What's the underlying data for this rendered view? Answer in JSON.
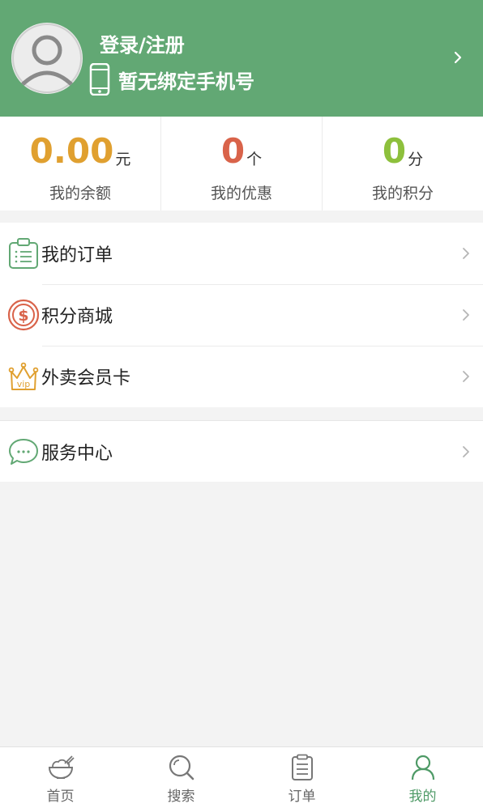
{
  "header": {
    "login_title": "登录/注册",
    "phone_text": "暂无绑定手机号",
    "bg_color": "#62a874"
  },
  "stats": [
    {
      "value": "0.00",
      "unit": "元",
      "label": "我的余额",
      "color": "#e0a030"
    },
    {
      "value": "0",
      "unit": "个",
      "label": "我的优惠",
      "color": "#d9634a"
    },
    {
      "value": "0",
      "unit": "分",
      "label": "我的积分",
      "color": "#8dc03c"
    }
  ],
  "menu": {
    "orders": {
      "label": "我的订单",
      "icon": "clipboard-list-icon"
    },
    "points_mall": {
      "label": "积分商城",
      "icon": "dollar-coin-icon"
    },
    "vip_card": {
      "label": "外卖会员卡",
      "icon": "vip-crown-icon"
    },
    "service_center": {
      "label": "服务中心",
      "icon": "chat-bubble-icon"
    }
  },
  "tabbar": {
    "home": "首页",
    "search": "搜索",
    "orders": "订单",
    "mine": "我的",
    "active_color": "#4e9a66"
  }
}
